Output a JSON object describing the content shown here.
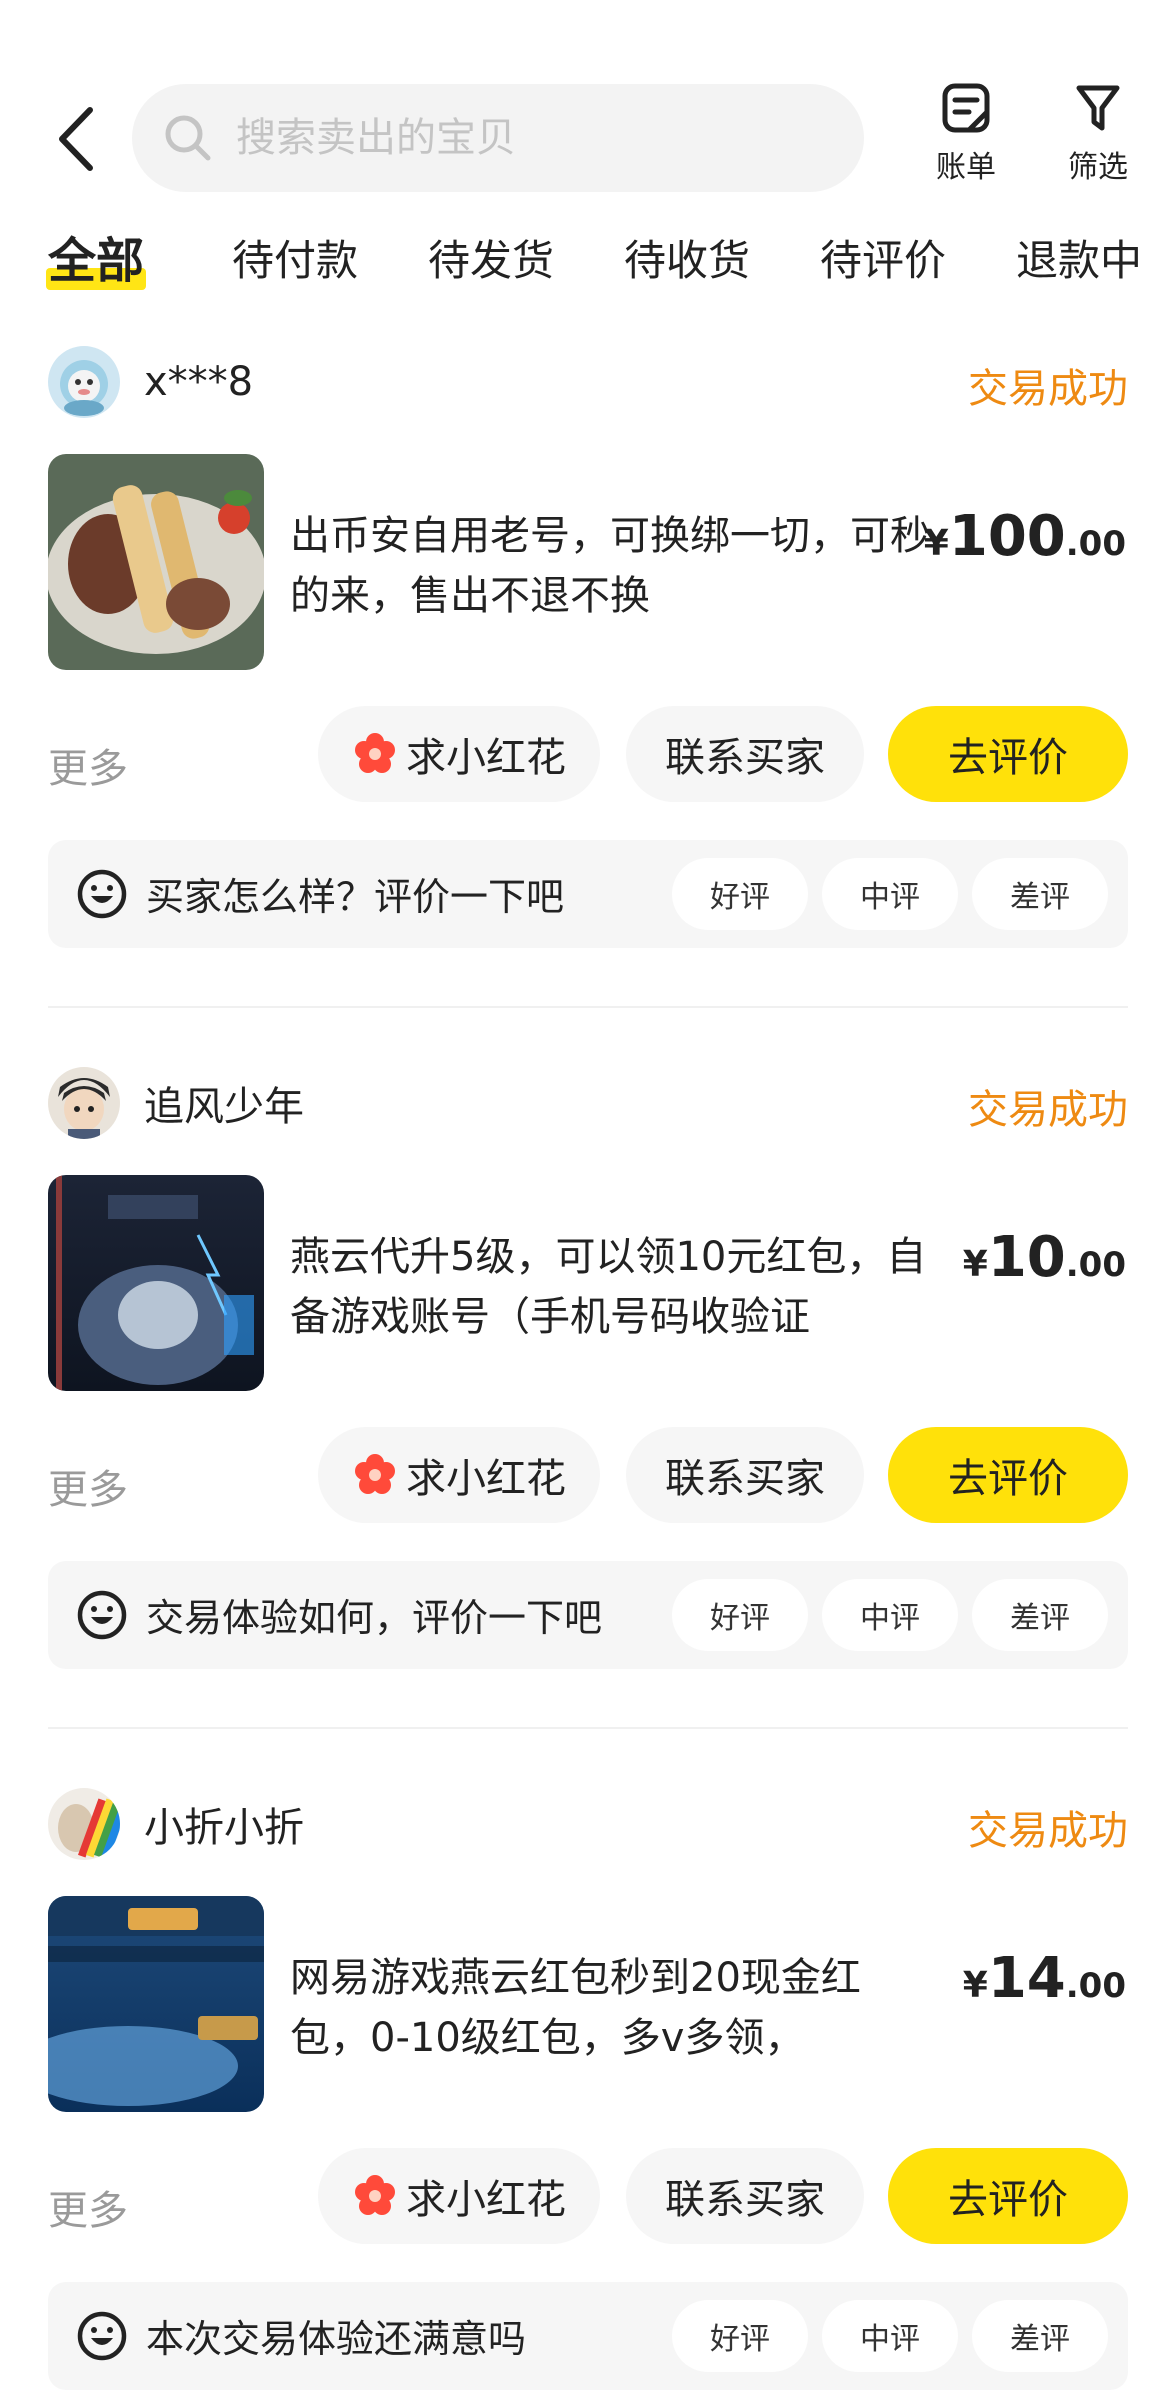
{
  "header": {
    "search_placeholder": "搜索卖出的宝贝",
    "bill_label": "账单",
    "filter_label": "筛选"
  },
  "tabs": [
    {
      "label": "全部",
      "active": true
    },
    {
      "label": "待付款"
    },
    {
      "label": "待发货"
    },
    {
      "label": "待收货"
    },
    {
      "label": "待评价"
    },
    {
      "label": "退款中"
    }
  ],
  "colors": {
    "accent": "#ffe10a",
    "status": "#ee8a12"
  },
  "orders": [
    {
      "buyer": "x***8",
      "status": "交易成功",
      "title": "出币安自用老号，可换绑一切，可秒的来，售出不退不换",
      "price_symbol": "¥",
      "price_int": "100",
      "price_dec": ".00",
      "more": "更多",
      "btn_flower": "求小红花",
      "btn_contact": "联系买家",
      "btn_review": "去评价",
      "rate_prompt": "买家怎么样？评价一下吧",
      "rate_good": "好评",
      "rate_mid": "中评",
      "rate_bad": "差评"
    },
    {
      "buyer": "追风少年",
      "status": "交易成功",
      "title": "燕云代升5级，可以领10元红包，自备游戏账号（手机号码收验证",
      "price_symbol": "¥",
      "price_int": "10",
      "price_dec": ".00",
      "more": "更多",
      "btn_flower": "求小红花",
      "btn_contact": "联系买家",
      "btn_review": "去评价",
      "rate_prompt": "交易体验如何，评价一下吧",
      "rate_good": "好评",
      "rate_mid": "中评",
      "rate_bad": "差评"
    },
    {
      "buyer": "小折小折",
      "status": "交易成功",
      "title": "网易游戏燕云红包秒到20现金红包，0-10级红包，多v多领，",
      "price_symbol": "¥",
      "price_int": "14",
      "price_dec": ".00",
      "more": "更多",
      "btn_flower": "求小红花",
      "btn_contact": "联系买家",
      "btn_review": "去评价",
      "rate_prompt": "本次交易体验还满意吗",
      "rate_good": "好评",
      "rate_mid": "中评",
      "rate_bad": "差评"
    }
  ]
}
